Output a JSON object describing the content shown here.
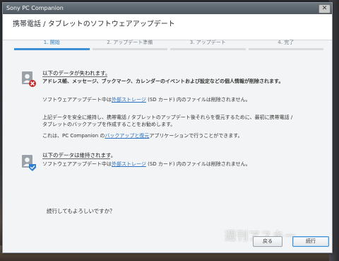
{
  "window": {
    "title": "Sony PC Companion",
    "close_glyph": "✕"
  },
  "header": {
    "title": "携帯電話 / タブレットのソフトウェアアップデート"
  },
  "steps": [
    {
      "label": "1. 開始",
      "active": true
    },
    {
      "label": "2. アップデート準備",
      "active": false
    },
    {
      "label": "3. アップデート",
      "active": false
    },
    {
      "label": "4. 完了",
      "active": false
    }
  ],
  "lost_section": {
    "icon": "user-delete-icon",
    "title": "以下のデータが失われます。",
    "line1": "アドレス帳、メッセージ、ブックマーク、カレンダーのイベントおよび設定などの個人情報が削除されます。",
    "line2_pre": "ソフトウェアアップデート中は",
    "line2_link": "外部ストレージ",
    "line2_post": " (SD カード) 内のファイルは削除されません。",
    "line3a": "上記データを安全に維持し、携帯電話 / タブレットのアップデート後それらを復元するために、",
    "line3a_bold": "最初に携帯電話 /",
    "line3b_bold": "タブレットのバックアップを作成する",
    "line3b": "ことをお勧めします。",
    "line4_pre": "これは、PC Companion の",
    "line4_link": "バックアップと復元",
    "line4_post": "アプリケーションで行うことができます。"
  },
  "kept_section": {
    "icon": "user-check-icon",
    "title": "以下のデータは維持されます。",
    "line1_pre": "ソフトウェアアップデート中は",
    "line1_link": "外部ストレージ",
    "line1_post": " (SD カード) 内のファイルは削除されません。"
  },
  "question": "続行してもよろしいですか？",
  "buttons": {
    "back": "戻る",
    "continue": "続行"
  },
  "watermark": "週刊アスキー",
  "colors": {
    "accent": "#3d8fd6",
    "link": "#2a6fc0",
    "danger": "#c62828"
  }
}
